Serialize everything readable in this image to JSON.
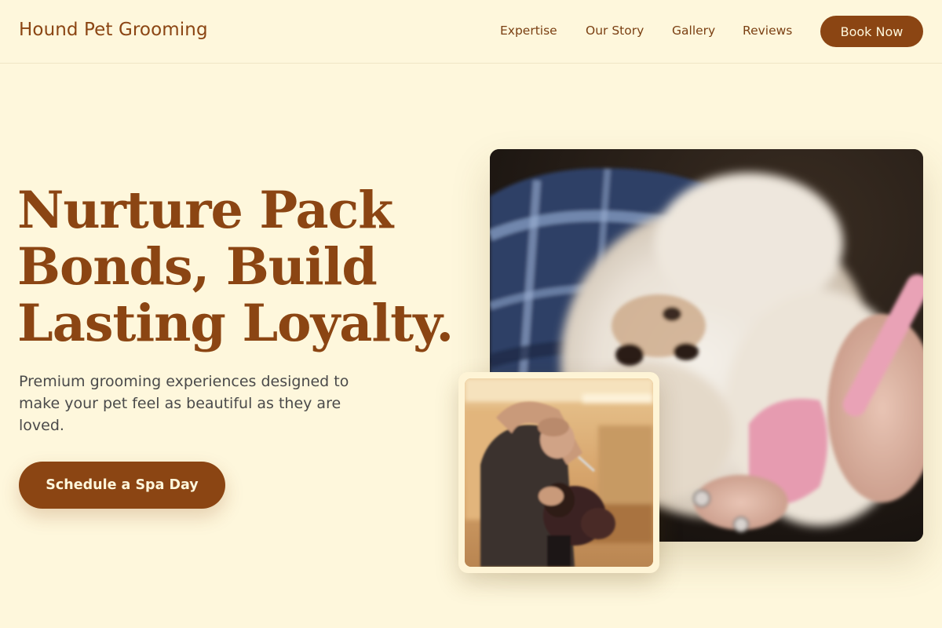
{
  "header": {
    "brand": "Hound Pet Grooming",
    "nav": {
      "expertise": "Expertise",
      "our_story": "Our Story",
      "gallery": "Gallery",
      "reviews": "Reviews"
    },
    "book_label": "Book Now"
  },
  "hero": {
    "headline_lines": [
      "Nurture Pack",
      "Bonds, Build",
      "Lasting Loyalty."
    ],
    "subtext": "Premium grooming experiences designed to make your pet feel as beautiful as they are loved.",
    "cta_label": "Schedule a Spa Day"
  },
  "colors": {
    "background": "#fef7dc",
    "brand": "#8b4513",
    "text_muted": "#4a4a4a"
  },
  "images": {
    "main": "fluffy-white-dog-being-brushed",
    "secondary": "groomer-trimming-dark-poodle"
  }
}
